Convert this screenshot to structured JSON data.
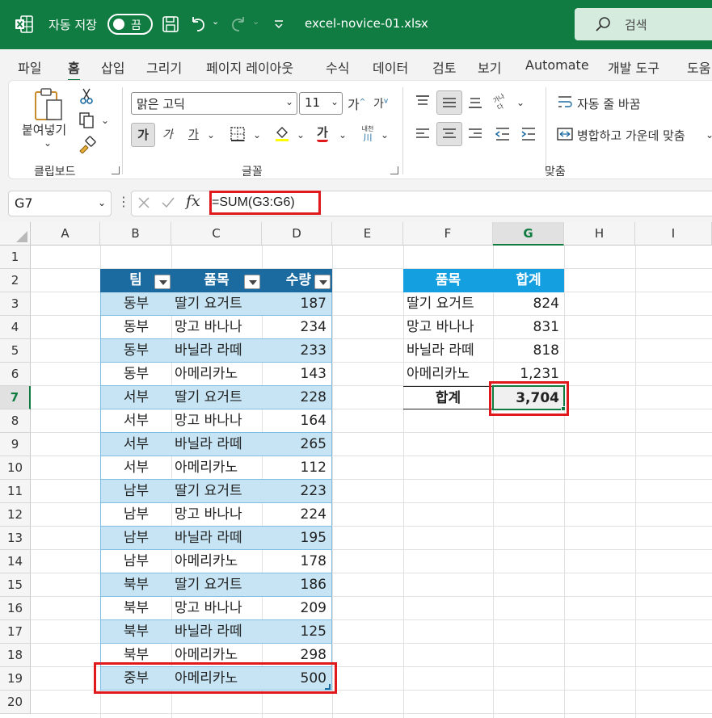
{
  "titlebar": {
    "autosave_label": "자동 저장",
    "autosave_state": "끔",
    "filename": "excel-novice-01.xlsx",
    "search_placeholder": "검색"
  },
  "tabs": [
    "파일",
    "홈",
    "삽입",
    "그리기",
    "페이지 레이아웃",
    "수식",
    "데이터",
    "검토",
    "보기",
    "Automate",
    "개발 도구",
    "도움"
  ],
  "active_tab": "홈",
  "ribbon": {
    "clipboard": {
      "paste": "붙여넣기",
      "group_label": "클립보드"
    },
    "font": {
      "font_name": "맑은 고딕",
      "font_size": "11",
      "grow": "가",
      "shrink": "가",
      "bold": "가",
      "italic": "가",
      "underline": "가",
      "font_color": "가",
      "phonetic_top": "내천",
      "phonetic_bottom": "川",
      "group_label": "글꼴"
    },
    "alignment": {
      "orientation_top": "가나",
      "orientation_bottom": "다",
      "wrap_text": "자동 줄 바꿈",
      "merge_center": "병합하고 가운데 맞춤",
      "group_label": "맞춤"
    }
  },
  "formula_bar": {
    "name_box": "G7",
    "formula": "=SUM(G3:G6)",
    "fx": "fx"
  },
  "columns": [
    "A",
    "B",
    "C",
    "D",
    "E",
    "F",
    "G",
    "H",
    "I"
  ],
  "rows": [
    "1",
    "2",
    "3",
    "4",
    "5",
    "6",
    "7",
    "8",
    "9",
    "10",
    "11",
    "12",
    "13",
    "14",
    "15",
    "16",
    "17",
    "18",
    "19",
    "20"
  ],
  "table1": {
    "headers": [
      "팀",
      "품목",
      "수량"
    ],
    "rows": [
      [
        "동부",
        "딸기 요거트",
        "187"
      ],
      [
        "동부",
        "망고 바나나",
        "234"
      ],
      [
        "동부",
        "바닐라 라떼",
        "233"
      ],
      [
        "동부",
        "아메리카노",
        "143"
      ],
      [
        "서부",
        "딸기 요거트",
        "228"
      ],
      [
        "서부",
        "망고 바나나",
        "164"
      ],
      [
        "서부",
        "바닐라 라떼",
        "265"
      ],
      [
        "서부",
        "아메리카노",
        "112"
      ],
      [
        "남부",
        "딸기 요거트",
        "223"
      ],
      [
        "남부",
        "망고 바나나",
        "224"
      ],
      [
        "남부",
        "바닐라 라떼",
        "195"
      ],
      [
        "남부",
        "아메리카노",
        "178"
      ],
      [
        "북부",
        "딸기 요거트",
        "186"
      ],
      [
        "북부",
        "망고 바나나",
        "209"
      ],
      [
        "북부",
        "바닐라 라떼",
        "125"
      ],
      [
        "북부",
        "아메리카노",
        "298"
      ],
      [
        "중부",
        "아메리카노",
        "500"
      ]
    ]
  },
  "table2": {
    "headers": [
      "품목",
      "합계"
    ],
    "rows": [
      [
        "딸기 요거트",
        "824"
      ],
      [
        "망고 바나나",
        "831"
      ],
      [
        "바닐라 라떼",
        "818"
      ],
      [
        "아메리카노",
        "1,231"
      ]
    ],
    "total_label": "합계",
    "total_value": "3,704"
  },
  "colors": {
    "excel_green": "#107c41",
    "table_header": "#1b6aa0",
    "table_band": "#c6e4f3",
    "summary_header": "#14a0e0",
    "highlight": "#e0191d"
  }
}
